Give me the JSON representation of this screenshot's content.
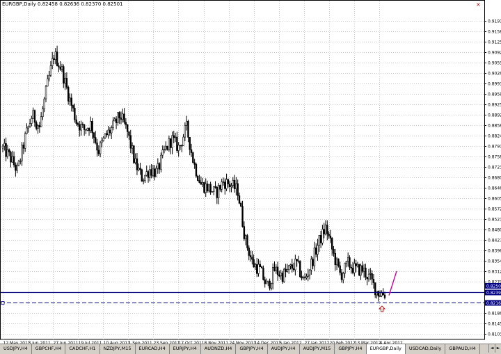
{
  "symbol_header": "EURGBP,Daily  0.82458 0.82636 0.82370 0.82501",
  "colors": {
    "grid": "#c8c8c8",
    "candles": "#000000",
    "support_line": "#000080",
    "bid_label_bg": "#000080",
    "trend_line": "#cc0099",
    "arrow": "#c00000"
  },
  "icons": {
    "close": "close-icon",
    "arrow": "up-arrow-icon"
  },
  "price_labels": [
    "0.91910",
    "0.91580",
    "0.91250",
    "0.90920",
    "0.90590",
    "0.90260",
    "0.89910",
    "0.89580",
    "0.89250",
    "0.88920",
    "0.88580",
    "0.88240",
    "0.87910",
    "0.87580",
    "0.87230",
    "0.86800",
    "0.86460",
    "0.86050",
    "0.85720",
    "0.85210",
    "0.84800",
    "0.84270",
    "0.83960",
    "0.83540",
    "0.83120",
    "0.82700",
    "0.82394",
    "0.82165",
    "0.81865",
    "0.81450",
    "0.81030"
  ],
  "bid_label": "0.82501",
  "support_label": "0.82394",
  "dashed_label": "0.82165",
  "date_labels": [
    "12 May 2011",
    "3 Jun 2011",
    "27 Jun 2011",
    "19 Jul 2011",
    "10 Aug 2011",
    "1 Sep 2011",
    "23 Sep 2011",
    "17 Oct 2011",
    "8 Nov 2011",
    "24 Nov 2011",
    "14 Dec 2011",
    "5 Jan 2012",
    "27 Jan 2012",
    "20 Feb 2012",
    "13 Mar 2012",
    "4 Apr 2012"
  ],
  "chart_data": {
    "type": "candlestick",
    "symbol": "EURGBP",
    "timeframe": "Daily",
    "ohlc_current": {
      "open": 0.82458,
      "high": 0.82636,
      "low": 0.8237,
      "close": 0.82501
    },
    "horizontal_levels": [
      {
        "price": 0.82394,
        "style": "solid"
      },
      {
        "price": 0.82165,
        "style": "dashed"
      }
    ],
    "close_path": [
      {
        "date": "12 May 2011",
        "close": 0.873
      },
      {
        "date": "20 May 2011",
        "close": 0.87
      },
      {
        "date": "27 May 2011",
        "close": 0.8655
      },
      {
        "date": "3 Jun 2011",
        "close": 0.876
      },
      {
        "date": "10 Jun 2011",
        "close": 0.884
      },
      {
        "date": "17 Jun 2011",
        "close": 0.88
      },
      {
        "date": "22 Jun 2011",
        "close": 0.893
      },
      {
        "date": "27 Jun 2011",
        "close": 0.904
      },
      {
        "date": "1 Jul 2011",
        "close": 0.899
      },
      {
        "date": "7 Jul 2011",
        "close": 0.89
      },
      {
        "date": "13 Jul 2011",
        "close": 0.882
      },
      {
        "date": "19 Jul 2011",
        "close": 0.879
      },
      {
        "date": "26 Jul 2011",
        "close": 0.881
      },
      {
        "date": "2 Aug 2011",
        "close": 0.872
      },
      {
        "date": "10 Aug 2011",
        "close": 0.877
      },
      {
        "date": "17 Aug 2011",
        "close": 0.88
      },
      {
        "date": "24 Aug 2011",
        "close": 0.884
      },
      {
        "date": "1 Sep 2011",
        "close": 0.878
      },
      {
        "date": "8 Sep 2011",
        "close": 0.868
      },
      {
        "date": "15 Sep 2011",
        "close": 0.863
      },
      {
        "date": "23 Sep 2011",
        "close": 0.866
      },
      {
        "date": "30 Sep 2011",
        "close": 0.865
      },
      {
        "date": "6 Oct 2011",
        "close": 0.872
      },
      {
        "date": "12 Oct 2011",
        "close": 0.876
      },
      {
        "date": "17 Oct 2011",
        "close": 0.873
      },
      {
        "date": "24 Oct 2011",
        "close": 0.88
      },
      {
        "date": "28 Oct 2011",
        "close": 0.868
      },
      {
        "date": "2 Nov 2011",
        "close": 0.861
      },
      {
        "date": "8 Nov 2011",
        "close": 0.86
      },
      {
        "date": "16 Nov 2011",
        "close": 0.858
      },
      {
        "date": "24 Nov 2011",
        "close": 0.862
      },
      {
        "date": "1 Dec 2011",
        "close": 0.861
      },
      {
        "date": "7 Dec 2011",
        "close": 0.859
      },
      {
        "date": "14 Dec 2011",
        "close": 0.843
      },
      {
        "date": "20 Dec 2011",
        "close": 0.835
      },
      {
        "date": "28 Dec 2011",
        "close": 0.833
      },
      {
        "date": "5 Jan 2012",
        "close": 0.827
      },
      {
        "date": "12 Jan 2012",
        "close": 0.833
      },
      {
        "date": "20 Jan 2012",
        "close": 0.831
      },
      {
        "date": "27 Jan 2012",
        "close": 0.833
      },
      {
        "date": "3 Feb 2012",
        "close": 0.835
      },
      {
        "date": "10 Feb 2012",
        "close": 0.829
      },
      {
        "date": "17 Feb 2012",
        "close": 0.835
      },
      {
        "date": "20 Feb 2012",
        "close": 0.842
      },
      {
        "date": "24 Feb 2012",
        "close": 0.847
      },
      {
        "date": "29 Feb 2012",
        "close": 0.838
      },
      {
        "date": "6 Mar 2012",
        "close": 0.831
      },
      {
        "date": "13 Mar 2012",
        "close": 0.835
      },
      {
        "date": "20 Mar 2012",
        "close": 0.833
      },
      {
        "date": "27 Mar 2012",
        "close": 0.833
      },
      {
        "date": "30 Mar 2012",
        "close": 0.83
      },
      {
        "date": "4 Apr 2012",
        "close": 0.8255
      },
      {
        "date": "6 Apr 2012",
        "close": 0.825
      }
    ]
  },
  "tabs": [
    "USDJPY,H4",
    "GBPCHF,H4",
    "CADCHF,H1",
    "NZDJPY,M15",
    "EURCAD,H4",
    "EURJPY,H4",
    "AUDNZD,H4",
    "GBPJPY,H4",
    "AUDJPY,H4",
    "AUDJPY,M15",
    "GBPJPY,H4",
    "EURGBP,Daily",
    "USDCAD,Daily",
    "GBPAUD,H4"
  ],
  "active_tab_index": 11,
  "tab_nav": [
    "◄",
    "►"
  ]
}
